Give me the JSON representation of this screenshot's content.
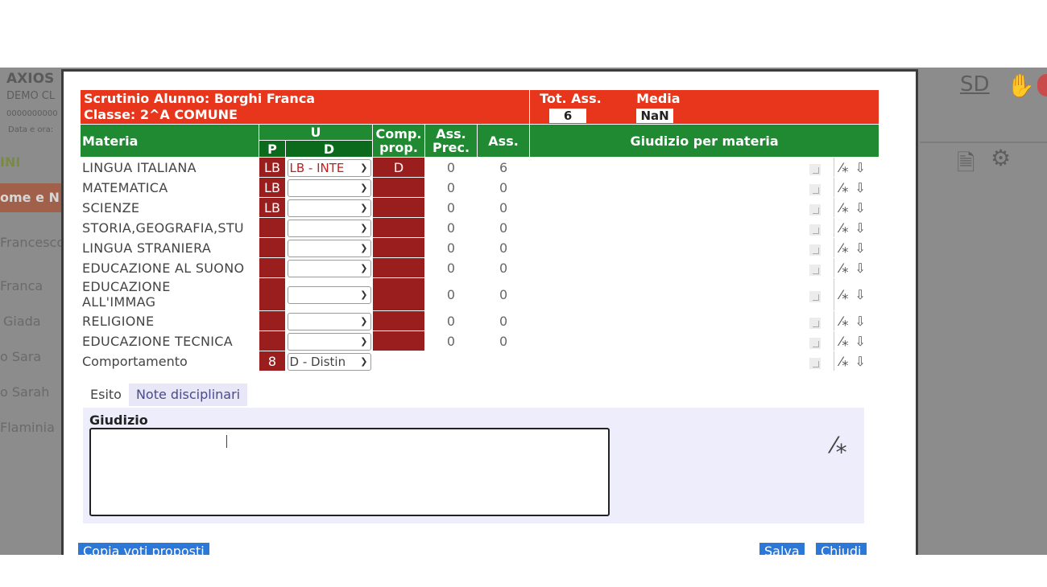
{
  "background": {
    "logo": "AXIOS",
    "demo": "DEMO CL",
    "code": "0000000000",
    "date": "Data e ora:",
    "ini": "INI",
    "cognome": "ome e N",
    "names": [
      "Francesco",
      "Franca",
      "Giada",
      "o Sara",
      "o Sarah",
      "Flaminia"
    ],
    "top_right_label": "SD"
  },
  "dialog": {
    "title_line1": "Scrutinio Alunno: Borghi Franca",
    "title_line2": "Classe: 2^A COMUNE",
    "tot_ass_label": "Tot. Ass.",
    "tot_ass_value": "6",
    "media_label": "Media",
    "media_value": "NaN",
    "headers": {
      "materia": "Materia",
      "u": "U",
      "p": "P",
      "d": "D",
      "comp1": "Comp.",
      "comp2": "prop.",
      "assprec1": "Ass.",
      "assprec2": "Prec.",
      "ass": "Ass.",
      "giudizio": "Giudizio per materia"
    },
    "rows": [
      {
        "materia": "LINGUA ITALIANA",
        "p": "LB",
        "d": "LB - INTE",
        "comp": "D",
        "ass_prec": "0",
        "ass": "6"
      },
      {
        "materia": "MATEMATICA",
        "p": "LB",
        "d": "",
        "comp": "",
        "ass_prec": "0",
        "ass": "0"
      },
      {
        "materia": "SCIENZE",
        "p": "LB",
        "d": "",
        "comp": "",
        "ass_prec": "0",
        "ass": "0"
      },
      {
        "materia": "STORIA,GEOGRAFIA,STU",
        "p": "",
        "d": "",
        "comp": "",
        "ass_prec": "0",
        "ass": "0"
      },
      {
        "materia": "LINGUA STRANIERA",
        "p": "",
        "d": "",
        "comp": "",
        "ass_prec": "0",
        "ass": "0"
      },
      {
        "materia": "EDUCAZIONE AL SUONO",
        "p": "",
        "d": "",
        "comp": "",
        "ass_prec": "0",
        "ass": "0"
      },
      {
        "materia": "EDUCAZIONE ALL'IMMAG",
        "materia_l1": "EDUCAZIONE",
        "materia_l2": "ALL'IMMAG",
        "p": "",
        "d": "",
        "comp": "",
        "ass_prec": "0",
        "ass": "0"
      },
      {
        "materia": "RELIGIONE",
        "p": "",
        "d": "",
        "comp": "",
        "ass_prec": "0",
        "ass": "0"
      },
      {
        "materia": "EDUCAZIONE TECNICA",
        "p": "",
        "d": "",
        "comp": "",
        "ass_prec": "0",
        "ass": "0"
      },
      {
        "materia": "Comportamento",
        "p": "8",
        "d": "D - Distin",
        "comp": "",
        "ass_prec": "",
        "ass": ""
      }
    ],
    "tabs": {
      "esito": "Esito",
      "note": "Note disciplinari"
    },
    "giudizio_label": "Giudizio",
    "giudizio_value": "",
    "buttons": {
      "copia": "Copia voti proposti",
      "salva": "Salva",
      "chiudi": "Chiudi"
    }
  }
}
